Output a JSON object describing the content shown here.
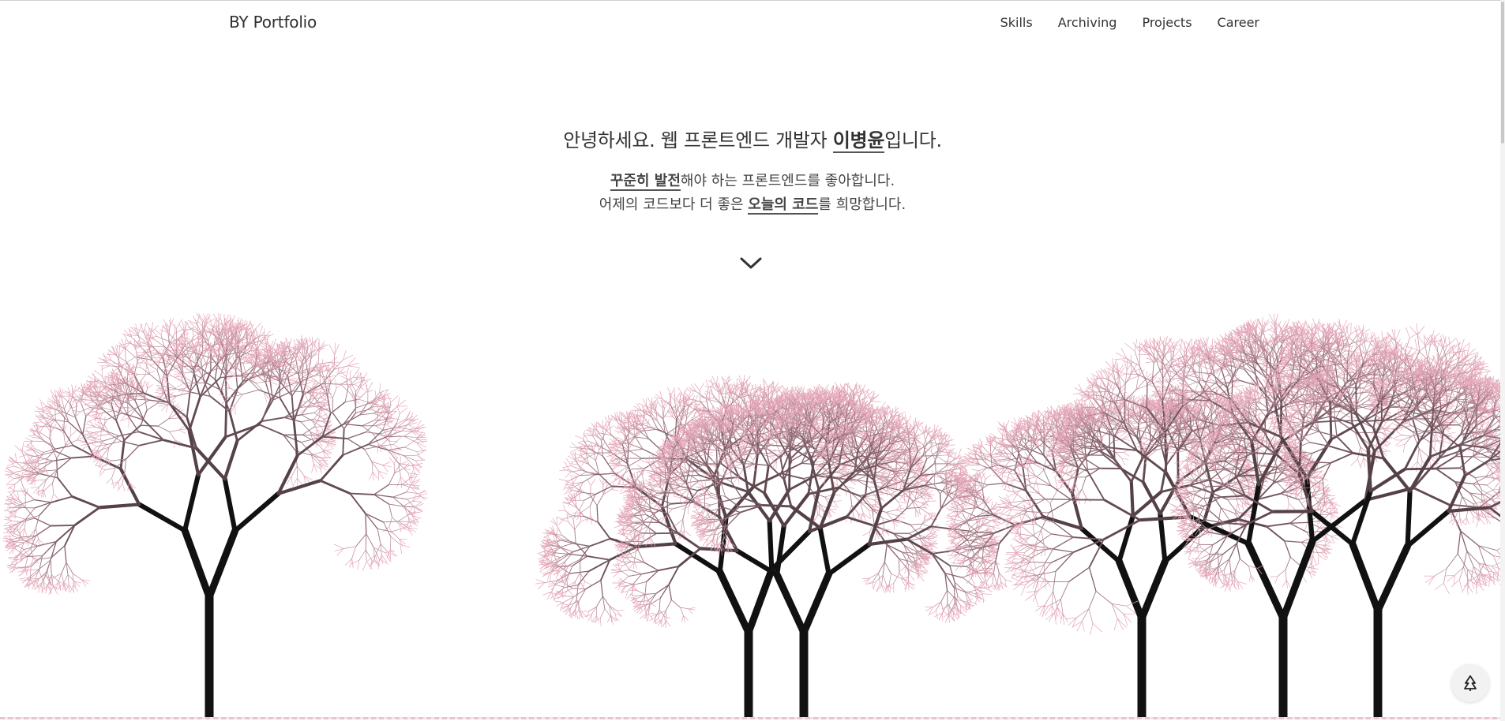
{
  "header": {
    "brand": "BY Portfolio",
    "nav": [
      "Skills",
      "Archiving",
      "Projects",
      "Career"
    ]
  },
  "hero": {
    "greeting_prefix": "안녕하세요. 웹 프론트엔드 개발자 ",
    "greeting_name": "이병윤",
    "greeting_suffix": "입니다.",
    "line1_strong": "꾸준히 발전",
    "line1_rest": "해야 하는 프론트엔드를 좋아합니다.",
    "line2_prefix": "어제의 코드보다 더 좋은 ",
    "line2_strong": "오늘의 코드",
    "line2_suffix": "를 희망합니다."
  },
  "icons": {
    "scroll_down": "chevron-down-icon",
    "fab": "tree-icon"
  },
  "colors": {
    "trunk": "#111111",
    "branch": "#4a3a3e",
    "blossom": "#e3a6b8",
    "background": "#ffffff"
  }
}
